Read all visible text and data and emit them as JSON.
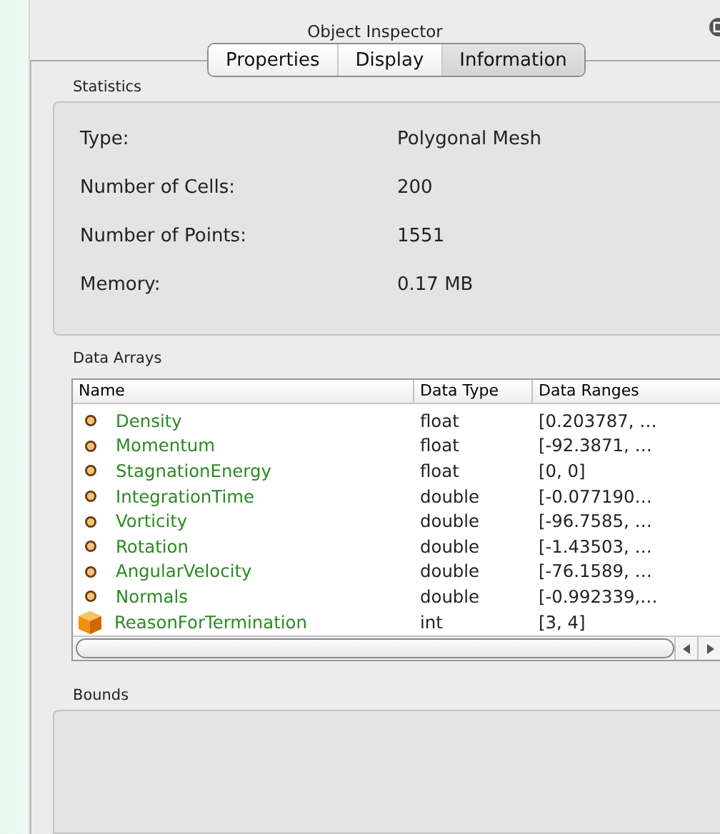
{
  "panel": {
    "title": "Object Inspector"
  },
  "tabs": [
    {
      "label": "Properties",
      "selected": false
    },
    {
      "label": "Display",
      "selected": false
    },
    {
      "label": "Information",
      "selected": true
    }
  ],
  "statistics": {
    "title": "Statistics",
    "rows": [
      {
        "label": "Type:",
        "value": "Polygonal Mesh"
      },
      {
        "label": "Number of Cells:",
        "value": "200"
      },
      {
        "label": "Number of Points:",
        "value": "1551"
      },
      {
        "label": "Memory:",
        "value": "0.17 MB"
      }
    ]
  },
  "data_arrays": {
    "title": "Data Arrays",
    "columns": [
      "Name",
      "Data Type",
      "Data Ranges"
    ],
    "rows": [
      {
        "kind": "point",
        "name": "Density",
        "type": "float",
        "range": "[0.203787, …"
      },
      {
        "kind": "point",
        "name": "Momentum",
        "type": "float",
        "range": "[-92.3871, …"
      },
      {
        "kind": "point",
        "name": "StagnationEnergy",
        "type": "float",
        "range": "[0, 0]"
      },
      {
        "kind": "point",
        "name": "IntegrationTime",
        "type": "double",
        "range": "[-0.077190…"
      },
      {
        "kind": "point",
        "name": "Vorticity",
        "type": "double",
        "range": "[-96.7585, …"
      },
      {
        "kind": "point",
        "name": "Rotation",
        "type": "double",
        "range": "[-1.43503, …"
      },
      {
        "kind": "point",
        "name": "AngularVelocity",
        "type": "double",
        "range": "[-76.1589, …"
      },
      {
        "kind": "point",
        "name": "Normals",
        "type": "double",
        "range": "[-0.992339,…"
      },
      {
        "kind": "cell",
        "name": "ReasonForTermination",
        "type": "int",
        "range": "[3, 4]"
      }
    ]
  },
  "bounds": {
    "title": "Bounds"
  }
}
